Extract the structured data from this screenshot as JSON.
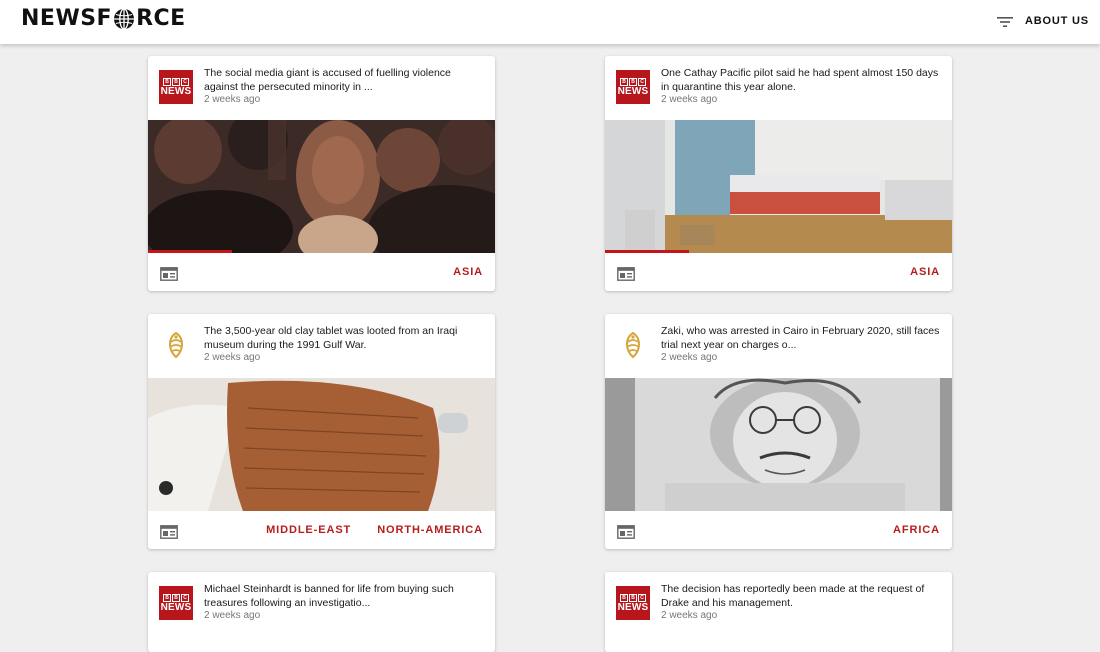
{
  "app": {
    "logo": "NEWSFORCE",
    "about_label": "ABOUT US",
    "accent_color": "#b71c1c"
  },
  "cards": [
    {
      "source": "BBC News",
      "source_logo_text": "NEWS",
      "title": "The social media giant is accused of fuelling violence against the persecuted minority in ...",
      "time": "2 weeks ago",
      "tags": [
        "ASIA"
      ],
      "progress_fraction": 0.24
    },
    {
      "source": "BBC News",
      "source_logo_text": "NEWS",
      "title": "One Cathay Pacific pilot said he had spent almost 150 days in quarantine this year alone.",
      "time": "2 weeks ago",
      "tags": [
        "ASIA"
      ],
      "progress_fraction": 0.24
    },
    {
      "source": "Al Jazeera",
      "title": "The 3,500-year old clay tablet was looted from an Iraqi museum during the 1991 Gulf War.",
      "time": "2 weeks ago",
      "tags": [
        "MIDDLE-EAST",
        "NORTH-AMERICA"
      ]
    },
    {
      "source": "Al Jazeera",
      "title": "Zaki, who was arrested in Cairo in February 2020, still faces trial next year on charges o...",
      "time": "2 weeks ago",
      "tags": [
        "AFRICA"
      ]
    },
    {
      "source": "BBC News",
      "source_logo_text": "NEWS",
      "title": "Michael Steinhardt is banned for life from buying such treasures following an investigatio...",
      "time": "2 weeks ago",
      "tags": []
    },
    {
      "source": "BBC News",
      "source_logo_text": "NEWS",
      "title": "The decision has reportedly been made at the request of Drake and his management.",
      "time": "2 weeks ago",
      "tags": []
    }
  ]
}
